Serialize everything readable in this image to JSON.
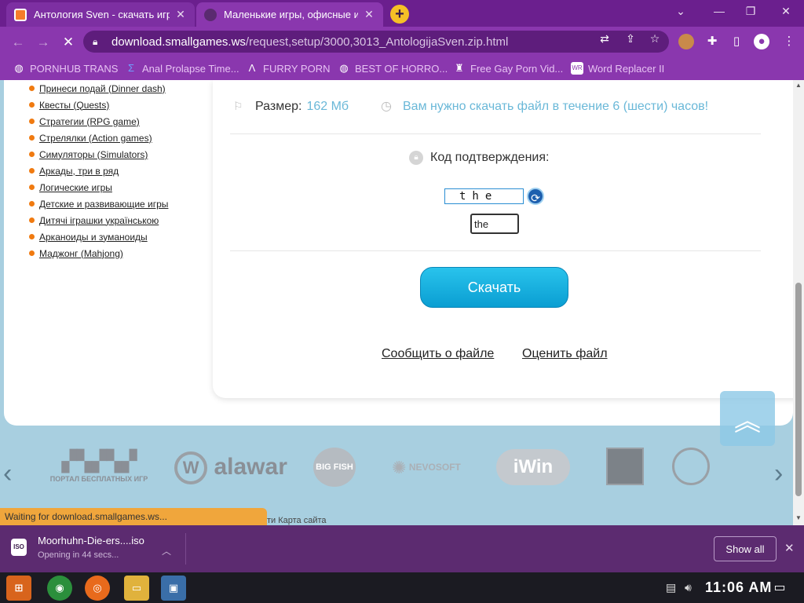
{
  "tabs": [
    {
      "title": "Антология Sven - скачать игр"
    },
    {
      "title": "Маленькие игры, офисные иг"
    }
  ],
  "address": {
    "host": "download.smallgames.ws",
    "path": "/request,setup/3000,3013_AntologijaSven.zip.html"
  },
  "bookmarks": [
    {
      "label": "PORNHUB TRANS",
      "icon": "globe-icon"
    },
    {
      "label": "Anal Prolapse Time...",
      "icon": "sigma-icon"
    },
    {
      "label": "FURRY PORN",
      "icon": "lambda-icon"
    },
    {
      "label": "BEST OF HORRO...",
      "icon": "globe-icon"
    },
    {
      "label": "Free Gay Porn Vid...",
      "icon": "bookmark-icon"
    },
    {
      "label": "Word Replacer II",
      "icon": "wr-icon"
    }
  ],
  "sidebar": {
    "items": [
      "Принеси подай (Dinner dash)",
      "Квесты (Quests)",
      "Стратегии (RPG game)",
      "Стрелялки (Action games)",
      "Симуляторы (Simulators)",
      "Аркады, три в ряд",
      "Логические игры",
      "Детские и развивающие игры",
      "Дитячі іграшки українською",
      "Арканоиды и зуманоиды",
      "Маджонг (Mahjong)"
    ]
  },
  "file": {
    "size_label": "Размер:",
    "size_value": "162 Мб",
    "time_notice": "Вам нужно скачать файл в течение 6 (шести) часов!",
    "captcha_label": "Код подтверждения:",
    "captcha_text": "the",
    "captcha_input_value": "the",
    "download_label": "Скачать",
    "report_link": "Сообщить о файле",
    "rate_link": "Оценить файл"
  },
  "partners": [
    "ПОРТАЛ БЕСПЛАТНЫХ ИГР",
    "alawar",
    "BIG FISH",
    "NEVOSOFT",
    "iWin",
    "",
    ""
  ],
  "status_text": "Waiting for download.smallgames.ws...",
  "footer_text": "ти Карта сайта",
  "download": {
    "filename": "Moorhuhn-Die-ers....iso",
    "status": "Opening in 44 secs...",
    "file_ext": "ISO",
    "show_all": "Show all"
  },
  "taskbar": {
    "clock": "11:06 AM"
  },
  "colors": {
    "accent": "#8a37ae",
    "download_button": "#0a9ed2",
    "link_blue": "#6ab8d8",
    "bullet_orange": "#f07a10"
  }
}
